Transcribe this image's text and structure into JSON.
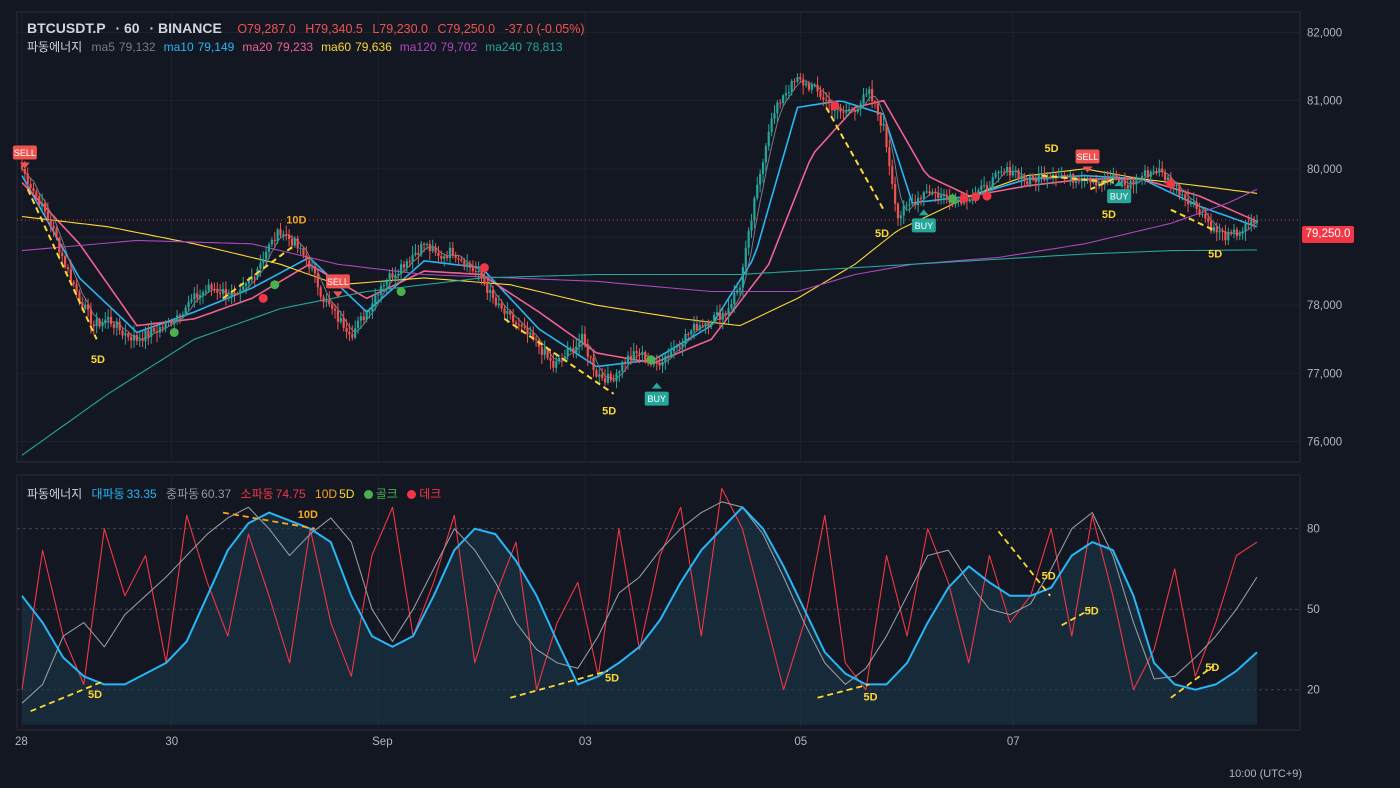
{
  "symbol": "BTCUSDT.P",
  "interval": "60",
  "exchange": "BINANCE",
  "ohlc": {
    "open": "O79,287.0",
    "high": "H79,340.5",
    "low": "L79,230.0",
    "close": "C79,250.0",
    "change": "-37.0 (-0.05%)"
  },
  "indicator_name": "파동에너지",
  "ma_legend": [
    {
      "label": "ma5",
      "value": "79,132",
      "color": "#787b86"
    },
    {
      "label": "ma10",
      "value": "79,149",
      "color": "#29b6f6"
    },
    {
      "label": "ma20",
      "value": "79,233",
      "color": "#f06292"
    },
    {
      "label": "ma60",
      "value": "79,636",
      "color": "#fdd835"
    },
    {
      "label": "ma120",
      "value": "79,702",
      "color": "#ab47bc"
    },
    {
      "label": "ma240",
      "value": "78,813",
      "color": "#26a69a"
    }
  ],
  "osc_legend": {
    "name": "파동에너지",
    "big": {
      "label": "대파동",
      "value": "33.35",
      "color": "#29b6f6"
    },
    "mid": {
      "label": "중파동",
      "value": "60.37",
      "color": "#9598a1"
    },
    "small": {
      "label": "소파동",
      "value": "74.75",
      "color": "#f23645"
    },
    "div10": "10D",
    "div5": "5D",
    "golden": "골크",
    "dead": "데크"
  },
  "last_price_tag": "79,250.0",
  "time_axis": [
    "28",
    "30",
    "Sep",
    "03",
    "05",
    "07"
  ],
  "timezone_label": "10:00 (UTC+9)",
  "signals": {
    "sell": "SELL",
    "buy": "BUY",
    "d5": "5D",
    "d10": "10D"
  },
  "colors": {
    "up": "#26a69a",
    "down": "#ef5350",
    "bg": "#131722",
    "grid": "#1e222d",
    "divergence": "#fdd835",
    "div10": "#f5a623"
  },
  "chart_data": [
    {
      "type": "candlestick",
      "title": "BTCUSDT.P · 60 · BINANCE",
      "ylim": [
        75700,
        82300
      ],
      "y_ticks": [
        76000,
        77000,
        78000,
        79000,
        80000,
        81000,
        82000
      ],
      "x_ticks": [
        "28",
        "30",
        "Sep",
        "03",
        "05",
        "07"
      ],
      "close_path": [
        [
          0,
          80000
        ],
        [
          5,
          79600
        ],
        [
          10,
          79200
        ],
        [
          15,
          78600
        ],
        [
          20,
          78100
        ],
        [
          25,
          77700
        ],
        [
          30,
          77800
        ],
        [
          35,
          77600
        ],
        [
          40,
          77500
        ],
        [
          45,
          77600
        ],
        [
          50,
          77700
        ],
        [
          55,
          77900
        ],
        [
          60,
          78100
        ],
        [
          65,
          78250
        ],
        [
          70,
          78200
        ],
        [
          75,
          78100
        ],
        [
          80,
          78400
        ],
        [
          85,
          78800
        ],
        [
          90,
          79100
        ],
        [
          95,
          78900
        ],
        [
          100,
          78600
        ],
        [
          105,
          78100
        ],
        [
          110,
          77800
        ],
        [
          115,
          77600
        ],
        [
          120,
          77900
        ],
        [
          125,
          78300
        ],
        [
          130,
          78500
        ],
        [
          135,
          78700
        ],
        [
          140,
          78900
        ],
        [
          145,
          78700
        ],
        [
          150,
          78800
        ],
        [
          155,
          78600
        ],
        [
          160,
          78400
        ],
        [
          165,
          78000
        ],
        [
          170,
          77800
        ],
        [
          175,
          77600
        ],
        [
          180,
          77400
        ],
        [
          185,
          77100
        ],
        [
          190,
          77300
        ],
        [
          195,
          77500
        ],
        [
          200,
          77000
        ],
        [
          205,
          76900
        ],
        [
          210,
          77200
        ],
        [
          215,
          77300
        ],
        [
          220,
          77100
        ],
        [
          225,
          77300
        ],
        [
          230,
          77500
        ],
        [
          235,
          77700
        ],
        [
          240,
          77800
        ],
        [
          245,
          77900
        ],
        [
          250,
          78300
        ],
        [
          255,
          79500
        ],
        [
          260,
          80600
        ],
        [
          265,
          81100
        ],
        [
          270,
          81300
        ],
        [
          275,
          81200
        ],
        [
          280,
          81000
        ],
        [
          285,
          80800
        ],
        [
          290,
          80900
        ],
        [
          295,
          81100
        ],
        [
          300,
          80600
        ],
        [
          305,
          79300
        ],
        [
          310,
          79500
        ],
        [
          315,
          79700
        ],
        [
          320,
          79600
        ],
        [
          325,
          79550
        ],
        [
          330,
          79600
        ],
        [
          335,
          79700
        ],
        [
          340,
          79900
        ],
        [
          345,
          80000
        ],
        [
          350,
          79800
        ],
        [
          355,
          79900
        ],
        [
          360,
          79950
        ],
        [
          365,
          79850
        ],
        [
          370,
          79900
        ],
        [
          375,
          79800
        ],
        [
          380,
          79850
        ],
        [
          385,
          79750
        ],
        [
          390,
          79900
        ],
        [
          395,
          80000
        ],
        [
          400,
          79800
        ],
        [
          405,
          79600
        ],
        [
          410,
          79400
        ],
        [
          415,
          79100
        ],
        [
          420,
          79000
        ],
        [
          425,
          79100
        ],
        [
          430,
          79250
        ]
      ],
      "moving_averages": {
        "ma10": [
          [
            0,
            79900
          ],
          [
            20,
            78400
          ],
          [
            40,
            77600
          ],
          [
            60,
            77900
          ],
          [
            80,
            78250
          ],
          [
            100,
            78700
          ],
          [
            120,
            77900
          ],
          [
            140,
            78650
          ],
          [
            160,
            78550
          ],
          [
            180,
            77650
          ],
          [
            200,
            77100
          ],
          [
            220,
            77200
          ],
          [
            240,
            77700
          ],
          [
            255,
            78700
          ],
          [
            270,
            80900
          ],
          [
            285,
            81000
          ],
          [
            300,
            80800
          ],
          [
            310,
            79500
          ],
          [
            330,
            79600
          ],
          [
            350,
            79850
          ],
          [
            370,
            79900
          ],
          [
            390,
            79850
          ],
          [
            410,
            79450
          ],
          [
            430,
            79150
          ]
        ],
        "ma20": [
          [
            0,
            79800
          ],
          [
            20,
            78900
          ],
          [
            40,
            77700
          ],
          [
            60,
            77800
          ],
          [
            80,
            78100
          ],
          [
            100,
            78600
          ],
          [
            120,
            78100
          ],
          [
            140,
            78500
          ],
          [
            160,
            78450
          ],
          [
            180,
            77900
          ],
          [
            200,
            77300
          ],
          [
            220,
            77150
          ],
          [
            240,
            77500
          ],
          [
            260,
            78600
          ],
          [
            275,
            80200
          ],
          [
            290,
            80900
          ],
          [
            300,
            81000
          ],
          [
            315,
            79900
          ],
          [
            330,
            79600
          ],
          [
            350,
            79750
          ],
          [
            370,
            79850
          ],
          [
            390,
            79850
          ],
          [
            410,
            79600
          ],
          [
            430,
            79230
          ]
        ],
        "ma60": [
          [
            0,
            79300
          ],
          [
            30,
            79150
          ],
          [
            60,
            78900
          ],
          [
            90,
            78600
          ],
          [
            110,
            78300
          ],
          [
            140,
            78400
          ],
          [
            170,
            78300
          ],
          [
            200,
            78000
          ],
          [
            230,
            77800
          ],
          [
            250,
            77700
          ],
          [
            270,
            78100
          ],
          [
            290,
            78600
          ],
          [
            305,
            79100
          ],
          [
            330,
            79600
          ],
          [
            350,
            79900
          ],
          [
            370,
            80000
          ],
          [
            390,
            79850
          ],
          [
            410,
            79750
          ],
          [
            430,
            79640
          ]
        ],
        "ma120": [
          [
            0,
            78800
          ],
          [
            40,
            78950
          ],
          [
            80,
            78900
          ],
          [
            110,
            78600
          ],
          [
            140,
            78450
          ],
          [
            170,
            78400
          ],
          [
            200,
            78350
          ],
          [
            240,
            78200
          ],
          [
            270,
            78200
          ],
          [
            290,
            78450
          ],
          [
            310,
            78600
          ],
          [
            340,
            78700
          ],
          [
            370,
            78900
          ],
          [
            400,
            79200
          ],
          [
            420,
            79500
          ],
          [
            430,
            79700
          ]
        ],
        "ma240": [
          [
            0,
            75800
          ],
          [
            30,
            76700
          ],
          [
            60,
            77500
          ],
          [
            90,
            77950
          ],
          [
            120,
            78200
          ],
          [
            160,
            78400
          ],
          [
            200,
            78450
          ],
          [
            250,
            78450
          ],
          [
            290,
            78550
          ],
          [
            330,
            78650
          ],
          [
            370,
            78750
          ],
          [
            400,
            78800
          ],
          [
            430,
            78810
          ]
        ]
      },
      "last_price": 79250
    },
    {
      "type": "line",
      "title": "파동에너지",
      "ylim": [
        5,
        100
      ],
      "y_ticks": [
        20,
        50,
        80
      ],
      "series": [
        {
          "name": "대파동",
          "color": "#29b6f6",
          "values": [
            55,
            45,
            32,
            25,
            22,
            22,
            26,
            30,
            38,
            55,
            72,
            82,
            86,
            83,
            80,
            75,
            55,
            40,
            36,
            40,
            55,
            72,
            80,
            78,
            68,
            55,
            38,
            22,
            25,
            30,
            36,
            46,
            60,
            72,
            80,
            88,
            80,
            66,
            50,
            34,
            26,
            22,
            22,
            30,
            45,
            58,
            66,
            60,
            55,
            55,
            58,
            70,
            75,
            72,
            55,
            30,
            22,
            20,
            22,
            27,
            34
          ]
        },
        {
          "name": "중파동",
          "color": "#9598a1",
          "values": [
            15,
            22,
            40,
            45,
            36,
            48,
            55,
            62,
            70,
            78,
            84,
            88,
            80,
            70,
            78,
            84,
            75,
            50,
            38,
            50,
            65,
            80,
            72,
            60,
            45,
            35,
            30,
            28,
            40,
            56,
            62,
            72,
            80,
            86,
            90,
            88,
            78,
            62,
            45,
            30,
            22,
            28,
            40,
            55,
            70,
            72,
            60,
            50,
            48,
            52,
            65,
            80,
            86,
            70,
            45,
            24,
            25,
            32,
            40,
            50,
            62
          ]
        },
        {
          "name": "소파동",
          "color": "#f23645",
          "values": [
            20,
            72,
            40,
            22,
            80,
            55,
            70,
            30,
            85,
            60,
            40,
            78,
            55,
            30,
            80,
            45,
            25,
            70,
            88,
            40,
            60,
            85,
            30,
            55,
            75,
            20,
            45,
            60,
            25,
            80,
            35,
            70,
            88,
            40,
            95,
            80,
            50,
            20,
            45,
            85,
            30,
            20,
            70,
            40,
            80,
            60,
            30,
            70,
            45,
            55,
            80,
            40,
            85,
            55,
            20,
            35,
            65,
            25,
            45,
            70,
            75
          ]
        }
      ]
    }
  ]
}
